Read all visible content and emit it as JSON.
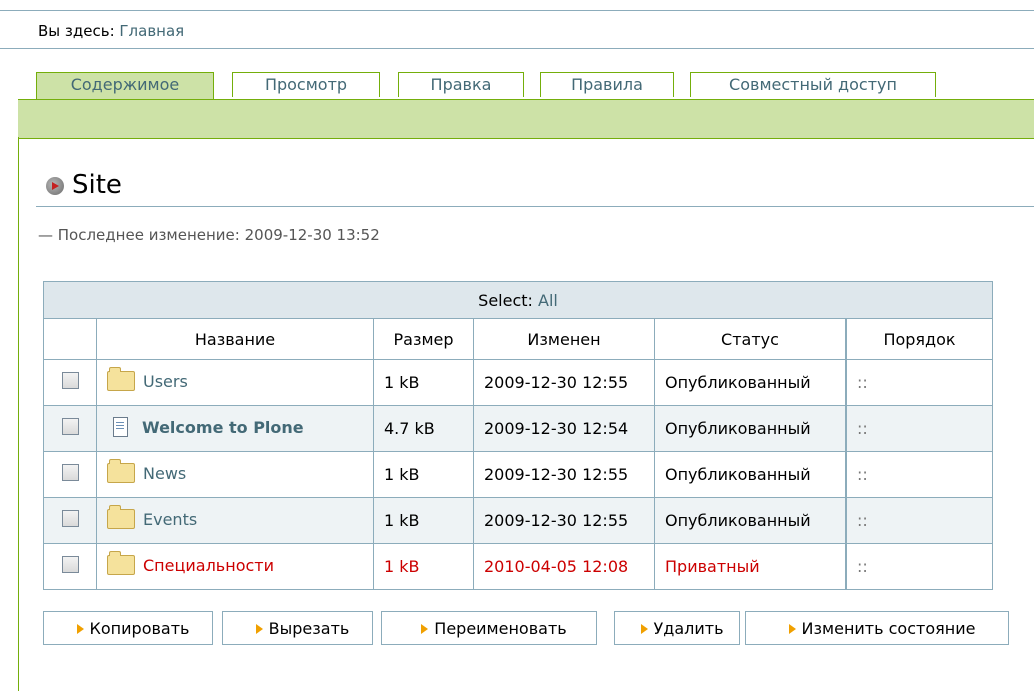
{
  "breadcrumb": {
    "prefix": "Вы здесь:",
    "home": "Главная"
  },
  "tabs": [
    {
      "label": "Содержимое",
      "active": true
    },
    {
      "label": "Просмотр",
      "active": false
    },
    {
      "label": "Правка",
      "active": false
    },
    {
      "label": "Правила",
      "active": false
    },
    {
      "label": "Совместный доступ",
      "active": false
    }
  ],
  "page": {
    "title": "Site",
    "last_modified": "— Последнее изменение: 2009-12-30 13:52"
  },
  "table": {
    "select_label": "Select:",
    "select_all": "All",
    "columns": [
      "Название",
      "Размер",
      "Изменен",
      "Статус",
      "Порядок"
    ],
    "rows": [
      {
        "icon": "folder-icon",
        "name": "Users",
        "size": "1 kB",
        "modified": "2009-12-30 12:55",
        "status": "Опубликованный",
        "order": "::",
        "private": false
      },
      {
        "icon": "document-icon",
        "name": "Welcome to Plone",
        "size": "4.7 kB",
        "modified": "2009-12-30 12:54",
        "status": "Опубликованный",
        "order": "::",
        "private": false
      },
      {
        "icon": "folder-icon",
        "name": "News",
        "size": "1 kB",
        "modified": "2009-12-30 12:55",
        "status": "Опубликованный",
        "order": "::",
        "private": false
      },
      {
        "icon": "folder-icon",
        "name": "Events",
        "size": "1 kB",
        "modified": "2009-12-30 12:55",
        "status": "Опубликованный",
        "order": "::",
        "private": false
      },
      {
        "icon": "folder-icon",
        "name": "Специальности",
        "size": "1 kB",
        "modified": "2010-04-05 12:08",
        "status": "Приватный",
        "order": "::",
        "private": true
      }
    ]
  },
  "buttons": {
    "copy": "Копировать",
    "cut": "Вырезать",
    "rename": "Переименовать",
    "delete": "Удалить",
    "change_state": "Изменить состояние"
  },
  "colors": {
    "accent_green": "#cde2a7",
    "border_blue": "#8cacbb",
    "link": "#436976",
    "private_red": "#cc0000"
  }
}
